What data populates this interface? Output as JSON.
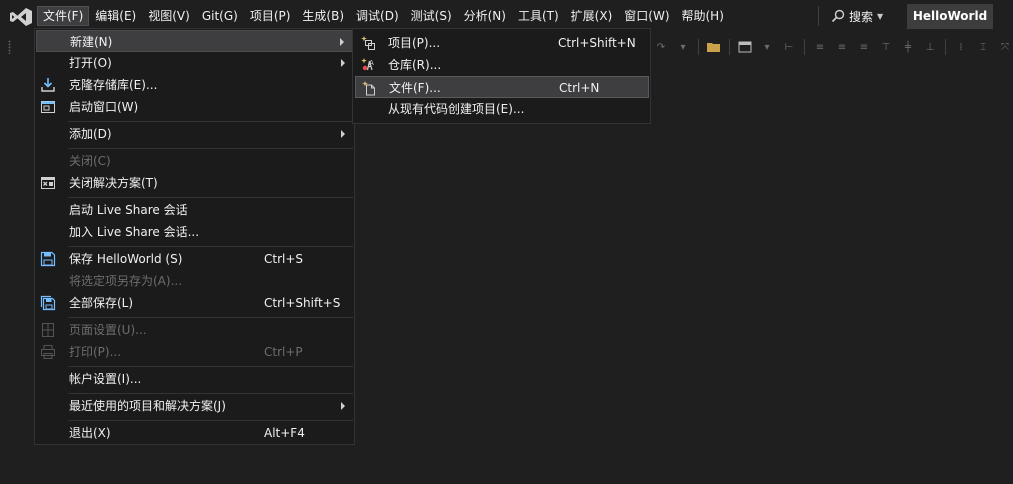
{
  "menubar": {
    "items": [
      {
        "label": "文件(F)",
        "active": true
      },
      {
        "label": "编辑(E)"
      },
      {
        "label": "视图(V)"
      },
      {
        "label": "Git(G)"
      },
      {
        "label": "项目(P)"
      },
      {
        "label": "生成(B)"
      },
      {
        "label": "调试(D)"
      },
      {
        "label": "测试(S)"
      },
      {
        "label": "分析(N)"
      },
      {
        "label": "工具(T)"
      },
      {
        "label": "扩展(X)"
      },
      {
        "label": "窗口(W)"
      },
      {
        "label": "帮助(H)"
      }
    ],
    "search_label": "搜索",
    "solution_title": "HelloWorld"
  },
  "file_menu": {
    "new": {
      "label": "新建(N)",
      "icon": "none",
      "submenu": true
    },
    "open": {
      "label": "打开(O)",
      "icon": "none",
      "submenu": true
    },
    "clone": {
      "label": "克隆存储库(E)...",
      "icon": "clone-icon"
    },
    "start_window": {
      "label": "启动窗口(W)",
      "icon": "start-window-icon"
    },
    "add": {
      "label": "添加(D)",
      "submenu": true
    },
    "close": {
      "label": "关闭(C)",
      "disabled": true
    },
    "close_solution": {
      "label": "关闭解决方案(T)",
      "icon": "close-solution-icon"
    },
    "live_share_start": {
      "label": "启动 Live Share 会话"
    },
    "live_share_join": {
      "label": "加入 Live Share 会话..."
    },
    "save": {
      "label": "保存 HelloWorld (S)",
      "shortcut": "Ctrl+S",
      "icon": "save-icon"
    },
    "save_as": {
      "label": "将选定项另存为(A)...",
      "disabled": true
    },
    "save_all": {
      "label": "全部保存(L)",
      "shortcut": "Ctrl+Shift+S",
      "icon": "save-all-icon"
    },
    "page_setup": {
      "label": "页面设置(U)...",
      "disabled": true,
      "icon": "page-setup-icon"
    },
    "print": {
      "label": "打印(P)...",
      "shortcut": "Ctrl+P",
      "disabled": true,
      "icon": "print-icon"
    },
    "account": {
      "label": "帐户设置(I)..."
    },
    "recent": {
      "label": "最近使用的项目和解决方案(J)",
      "submenu": true
    },
    "exit": {
      "label": "退出(X)",
      "shortcut": "Alt+F4"
    }
  },
  "new_submenu": {
    "project": {
      "label": "项目(P)...",
      "shortcut": "Ctrl+Shift+N",
      "icon": "new-project-icon"
    },
    "repository": {
      "label": "仓库(R)...",
      "icon": "new-repository-icon"
    },
    "file": {
      "label": "文件(F)...",
      "shortcut": "Ctrl+N",
      "icon": "new-file-icon",
      "highlighted": true
    },
    "from_existing": {
      "label": "从现有代码创建项目(E)..."
    }
  },
  "colors": {
    "background": "#1f1f1f",
    "menu_background": "#1b1b1c",
    "highlight": "#3e3e40",
    "text": "#f1f1f1",
    "disabled_text": "#6d6d6d",
    "icon_blue": "#75beff"
  }
}
